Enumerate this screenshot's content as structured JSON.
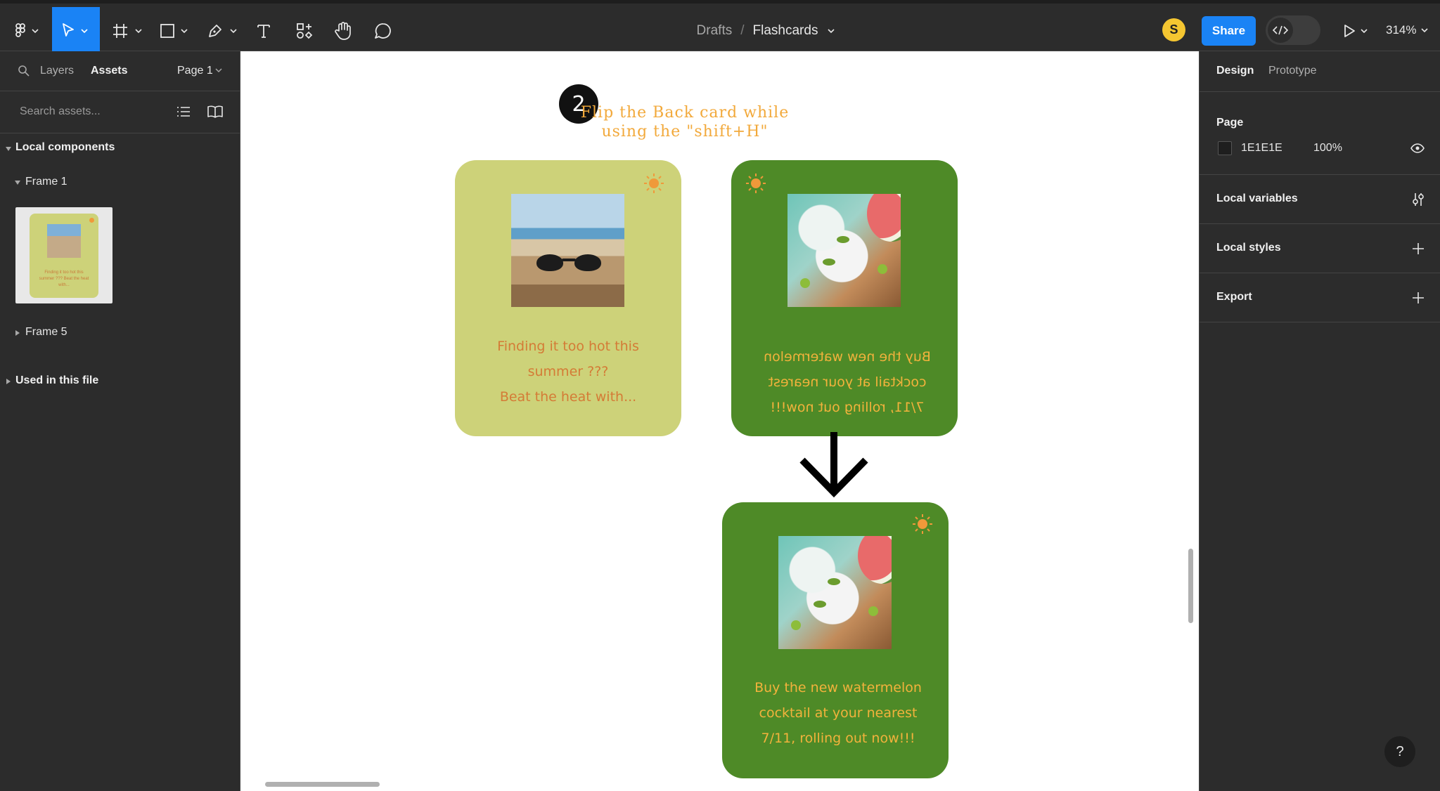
{
  "toolbar": {
    "breadcrumb_parent": "Drafts",
    "breadcrumb_separator": "/",
    "file_name": "Flashcards",
    "avatar_initial": "S",
    "share_label": "Share",
    "zoom": "314%"
  },
  "left_panel": {
    "tab_layers": "Layers",
    "tab_assets": "Assets",
    "page_selector": "Page 1",
    "search_placeholder": "Search assets...",
    "local_components": "Local components",
    "frame1": "Frame 1",
    "frame5": "Frame 5",
    "used_in_file": "Used in this file",
    "thumb_text": "Finding it too hot this summer ??? Beat the heat with..."
  },
  "canvas": {
    "step_number": "2",
    "step_instruction": "Flip the Back card while using the \"shift+H\"",
    "card_front_text": "Finding it too hot this summer ???\nBeat the heat with...",
    "card_back_mirrored_text": "Buy the new watermelon cocktail at your nearest 7/11, rolling out now!!!",
    "card_back_text": "Buy the new watermelon cocktail at your nearest 7/11, rolling out now!!!",
    "colors": {
      "card_front": "#cdd279",
      "card_back": "#4e8a27",
      "instruction": "#f2a93b"
    }
  },
  "right_panel": {
    "tab_design": "Design",
    "tab_prototype": "Prototype",
    "page_section": "Page",
    "page_color": "1E1E1E",
    "page_opacity": "100%",
    "local_variables": "Local variables",
    "local_styles": "Local styles",
    "export": "Export"
  },
  "help_label": "?"
}
